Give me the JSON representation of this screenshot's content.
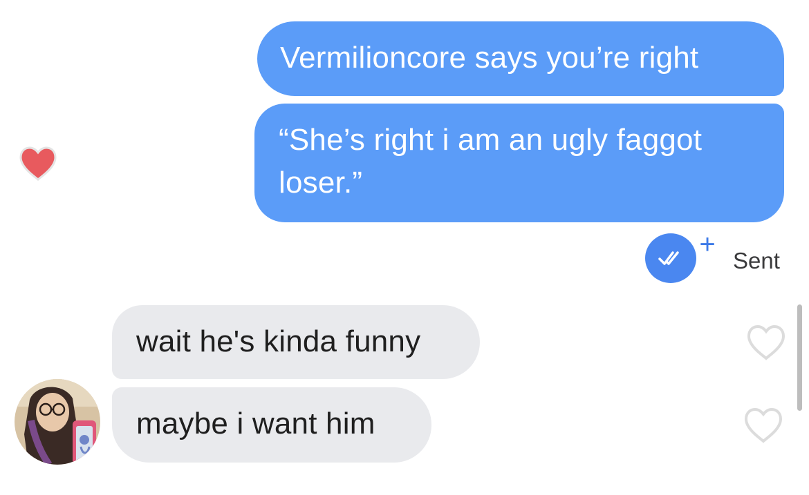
{
  "messages": {
    "outgoing": [
      "Vermilioncore says you’re right",
      "“She’s right i am an ugly faggot loser.”"
    ],
    "incoming": [
      "wait he's kinda funny",
      "maybe i want him"
    ]
  },
  "status": {
    "label": "Sent",
    "plus": "+"
  },
  "icons": {
    "reaction": "heart-filled-icon",
    "like": "heart-outline-icon",
    "receipt": "double-check-icon"
  },
  "colors": {
    "outgoing_bubble": "#5b9cf8",
    "incoming_bubble": "#e9eaed",
    "heart_red": "#e85a5e",
    "receipt_blue": "#4a87f0"
  }
}
